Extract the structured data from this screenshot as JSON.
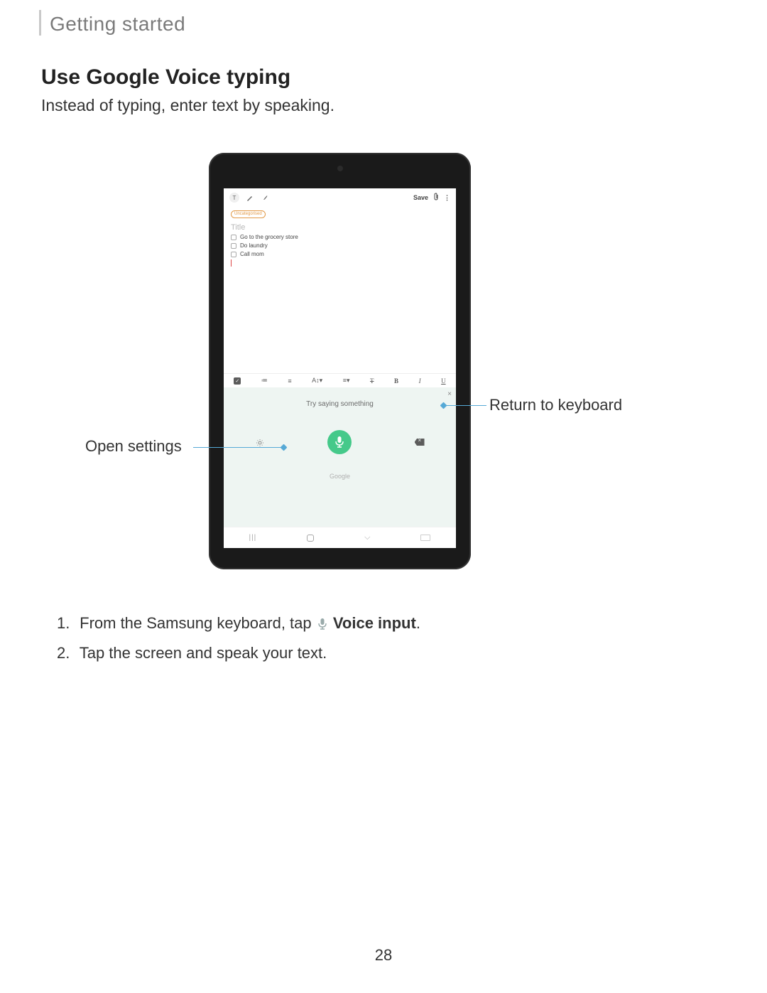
{
  "breadcrumb": "Getting started",
  "heading": "Use Google Voice typing",
  "intro": "Instead of typing, enter text by speaking.",
  "tablet": {
    "appbar": {
      "text_mode": "T",
      "save": "Save"
    },
    "chip": "Uncategorised",
    "title_placeholder": "Title",
    "notes": [
      "Go to the grocery store",
      "Do laundry",
      "Call mom"
    ],
    "fmt": {
      "bold": "B",
      "italic": "I",
      "underline": "U",
      "strike": "T"
    },
    "voice": {
      "close": "×",
      "prompt": "Try saying something",
      "brand": "Google"
    },
    "nav": {
      "recent": "|||"
    }
  },
  "callouts": {
    "left": "Open settings",
    "right": "Return to keyboard"
  },
  "steps": {
    "s1_a": "From the Samsung keyboard, tap",
    "s1_b": "Voice input",
    "s1_c": ".",
    "s2": "Tap the screen and speak your text."
  },
  "pagenum": "28"
}
